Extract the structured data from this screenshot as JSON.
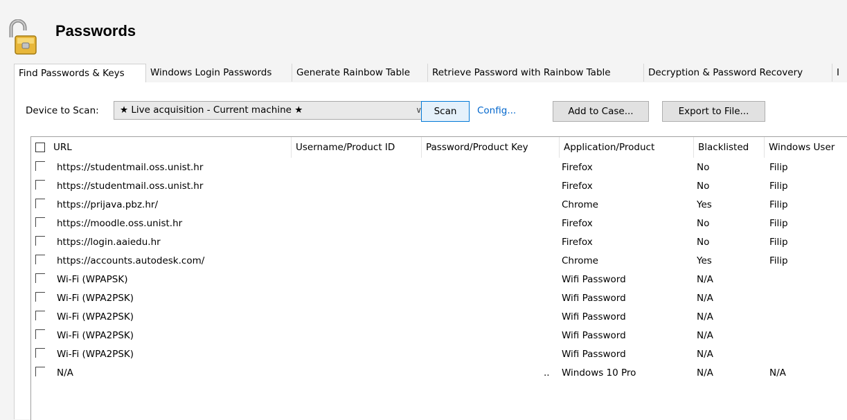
{
  "header": {
    "title": "Passwords",
    "icon": "padlock-open-icon"
  },
  "tabs": [
    {
      "label": "Find Passwords & Keys",
      "active": true
    },
    {
      "label": "Windows Login Passwords",
      "active": false
    },
    {
      "label": "Generate Rainbow Table",
      "active": false
    },
    {
      "label": "Retrieve Password with Rainbow Table",
      "active": false
    },
    {
      "label": "Decryption & Password Recovery",
      "active": false
    },
    {
      "label": "I",
      "active": false
    }
  ],
  "toolbar": {
    "device_label": "Device to Scan:",
    "device_value": "★ Live acquisition - Current machine ★",
    "scan_label": "Scan",
    "config_label": "Config...",
    "add_case_label": "Add to Case...",
    "export_label": "Export to File..."
  },
  "table": {
    "columns": [
      "URL",
      "Username/Product ID",
      "Password/Product Key",
      "Application/Product",
      "Blacklisted",
      "Windows User"
    ],
    "rows": [
      [
        "https://studentmail.oss.unist.hr",
        "",
        "",
        "Firefox",
        "No",
        "Filip"
      ],
      [
        "https://studentmail.oss.unist.hr",
        "",
        "",
        "Firefox",
        "No",
        "Filip"
      ],
      [
        "https://prijava.pbz.hr/",
        "",
        "",
        "Chrome",
        "Yes",
        "Filip"
      ],
      [
        "https://moodle.oss.unist.hr",
        "",
        "",
        "Firefox",
        "No",
        "Filip"
      ],
      [
        "https://login.aaiedu.hr",
        "",
        "",
        "Firefox",
        "No",
        "Filip"
      ],
      [
        "https://accounts.autodesk.com/",
        "",
        "",
        "Chrome",
        "Yes",
        "Filip"
      ],
      [
        "Wi-Fi (WPAPSK)",
        "",
        "",
        "Wifi Password",
        "N/A",
        ""
      ],
      [
        "Wi-Fi (WPA2PSK)",
        "",
        "",
        "Wifi Password",
        "N/A",
        ""
      ],
      [
        "Wi-Fi (WPA2PSK)",
        "",
        "",
        "Wifi Password",
        "N/A",
        ""
      ],
      [
        "Wi-Fi (WPA2PSK)",
        "",
        "",
        "Wifi Password",
        "N/A",
        ""
      ],
      [
        "Wi-Fi (WPA2PSK)",
        "",
        "",
        "Wifi Password",
        "N/A",
        ""
      ],
      [
        "N/A",
        "",
        "..",
        "Windows 10 Pro",
        "N/A",
        "N/A"
      ]
    ]
  }
}
